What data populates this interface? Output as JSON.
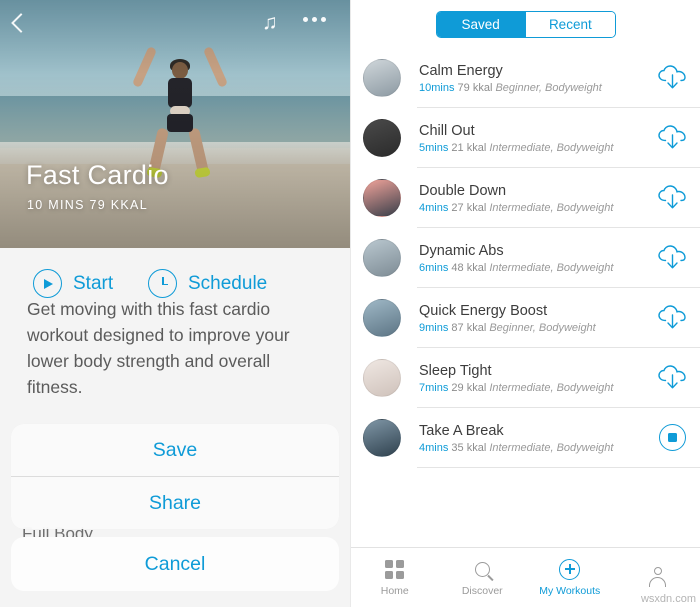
{
  "left_screen": {
    "hero": {
      "back_icon": "back-chevron-icon",
      "music_icon": "music-note-icon",
      "more_icon": "more-options-icon",
      "title": "Fast Cardio",
      "subtitle": "10 MINS   79 KKAL"
    },
    "actions": {
      "start_label": "Start",
      "schedule_label": "Schedule"
    },
    "description": "Get moving with this fast cardio workout designed to improve your lower body strength and overall fitness.",
    "body_part": "Full Body",
    "action_sheet": {
      "items": [
        {
          "label": "Save"
        },
        {
          "label": "Share"
        }
      ],
      "cancel_label": "Cancel"
    },
    "accent": "#0f9bd7"
  },
  "right_screen": {
    "segmented": {
      "options": [
        {
          "label": "Saved",
          "active": true
        },
        {
          "label": "Recent",
          "active": false
        }
      ]
    },
    "workouts": [
      {
        "title": "Calm Energy",
        "duration": "10mins",
        "kcal": "79 kkal",
        "tags": "Beginner, Bodyweight",
        "action": "download-icon",
        "thumb_colors": [
          "#cfd6da",
          "#8d9aa3"
        ]
      },
      {
        "title": "Chill Out",
        "duration": "5mins",
        "kcal": "21 kkal",
        "tags": "Intermediate, Bodyweight",
        "action": "download-icon",
        "thumb_colors": [
          "#4a4a4a",
          "#2b2b2b"
        ]
      },
      {
        "title": "Double Down",
        "duration": "4mins",
        "kcal": "27 kkal",
        "tags": "Intermediate, Bodyweight",
        "action": "download-icon",
        "thumb_colors": [
          "#f0a39a",
          "#3a3f4a"
        ]
      },
      {
        "title": "Dynamic Abs",
        "duration": "6mins",
        "kcal": "48 kkal",
        "tags": "Intermediate, Bodyweight",
        "action": "download-icon",
        "thumb_colors": [
          "#b9c7cf",
          "#7e8c95"
        ]
      },
      {
        "title": "Quick Energy Boost",
        "duration": "9mins",
        "kcal": "87 kkal",
        "tags": "Beginner, Bodyweight",
        "action": "download-icon",
        "thumb_colors": [
          "#9fb8c6",
          "#5d7585"
        ]
      },
      {
        "title": "Sleep Tight",
        "duration": "7mins",
        "kcal": "29 kkal",
        "tags": "Intermediate, Bodyweight",
        "action": "download-icon",
        "thumb_colors": [
          "#efe7e2",
          "#cfc2bb"
        ]
      },
      {
        "title": "Take A Break",
        "duration": "4mins",
        "kcal": "35 kkal",
        "tags": "Intermediate, Bodyweight",
        "action": "stop-button",
        "thumb_colors": [
          "#7f96a6",
          "#30424f"
        ]
      }
    ],
    "tabbar": [
      {
        "label": "Home",
        "icon": "grid-icon",
        "active": false
      },
      {
        "label": "Discover",
        "icon": "search-icon",
        "active": false
      },
      {
        "label": "My Workouts",
        "icon": "plus-circle-icon",
        "active": true
      },
      {
        "label": "",
        "icon": "person-icon",
        "active": false
      }
    ],
    "accent": "#0f9bd7"
  },
  "watermark": "wsxdn.com"
}
